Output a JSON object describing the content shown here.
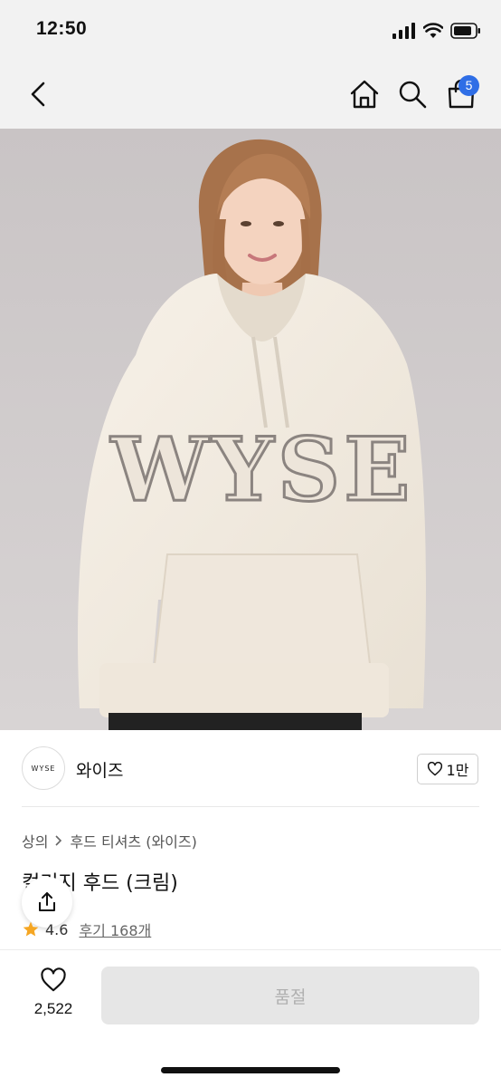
{
  "status_bar": {
    "time": "12:50"
  },
  "nav": {
    "cart_count": "5"
  },
  "hero": {
    "print_text": "WYSE"
  },
  "brand": {
    "logo_text": "WYSE",
    "name": "와이즈",
    "like_count": "1만"
  },
  "breadcrumb": {
    "level1": "상의",
    "level2": "후드 티셔츠 (와이즈)"
  },
  "product": {
    "title": "컬리지 후드 (크림)",
    "rating": "4.6",
    "reviews": "후기 168개"
  },
  "bottom": {
    "wish_count": "2,522",
    "buy_label": "품절"
  },
  "colors": {
    "accent": "#2f6ee6",
    "star": "#f5a623",
    "disabled_bg": "#e6e6e6",
    "disabled_text": "#b0b0b0"
  }
}
